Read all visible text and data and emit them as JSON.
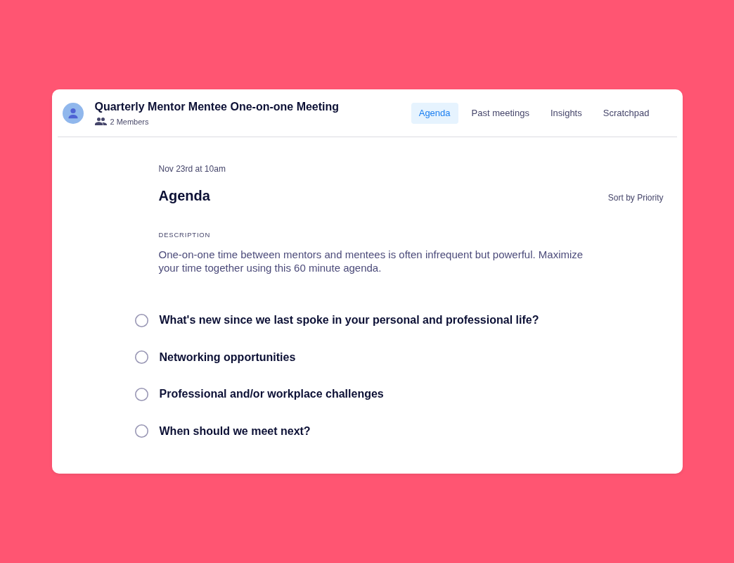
{
  "meeting": {
    "title": "Quarterly Mentor Mentee One-on-one Meeting",
    "members": "2 Members"
  },
  "tabs": [
    {
      "label": "Agenda",
      "selected": true
    },
    {
      "label": "Past meetings",
      "selected": false
    },
    {
      "label": "Insights",
      "selected": false
    },
    {
      "label": "Scratchpad",
      "selected": false
    }
  ],
  "agenda": {
    "date": "Nov 23rd at 10am",
    "heading": "Agenda",
    "sort": "Sort by Priority",
    "description_label": "DESCRIPTION",
    "description": "One-on-one time between mentors and mentees is often infrequent but powerful. Maximize your time together using this 60 minute agenda.",
    "items": [
      {
        "text": "What's new since we last spoke in your personal and professional life?",
        "checked": false
      },
      {
        "text": "Networking opportunities",
        "checked": false
      },
      {
        "text": "Professional and/or workplace challenges",
        "checked": false
      },
      {
        "text": "When should we meet next?",
        "checked": false
      }
    ]
  }
}
